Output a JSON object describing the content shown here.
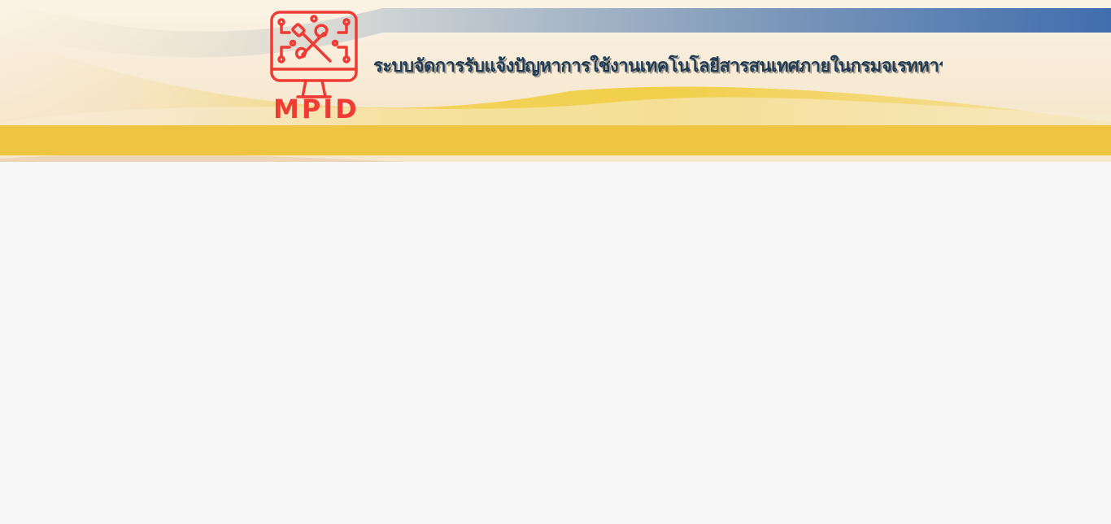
{
  "header": {
    "logo_text": "MPID",
    "site_title": "ระบบจัดการรับแจ้งปัญหาการใช้งานเทคโนโลยีสารสนเทศภายในกรมจเรทหารอากาศ"
  },
  "colors": {
    "logo_red": "#ee3b33",
    "title_text": "#1f3b55",
    "yellow_bar": "#efc441",
    "blue_stripe": "#2b5fa8",
    "page_background": "#f7f7f7"
  },
  "icons": {
    "logo": "monitor-with-wrench-and-circuit-icon"
  }
}
